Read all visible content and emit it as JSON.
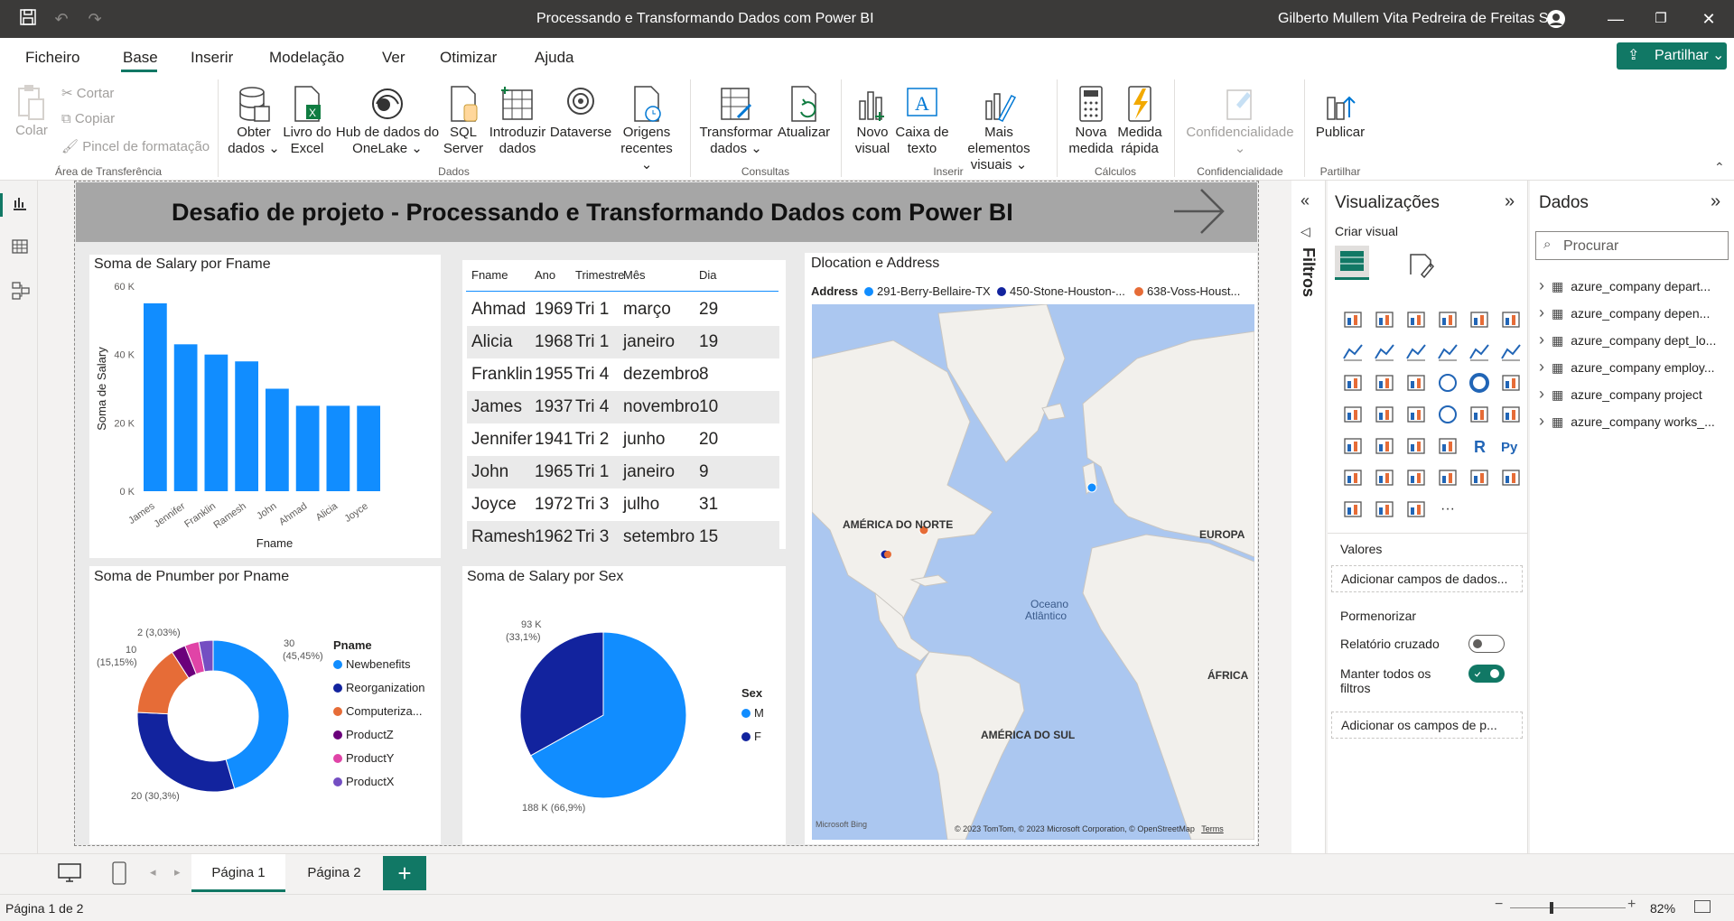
{
  "window": {
    "title": "Processando e Transformando Dados com Power BI",
    "user": "Gilberto Mullem Vita Pedreira de Freitas Sá"
  },
  "menu": [
    "Ficheiro",
    "Base",
    "Inserir",
    "Modelação",
    "Ver",
    "Otimizar",
    "Ajuda"
  ],
  "share_label": "Partilhar",
  "ribbon": {
    "paste": "Colar",
    "cut": "Cortar",
    "copy": "Copiar",
    "format_painter": "Pincel de formatação",
    "get_data_1": "Obter",
    "get_data_2": "dados",
    "excel_1": "Livro do",
    "excel_2": "Excel",
    "onelake_1": "Hub de dados do",
    "onelake_2": "OneLake",
    "sql_1": "SQL",
    "sql_2": "Server",
    "enter_1": "Introduzir",
    "enter_2": "dados",
    "dataverse": "Dataverse",
    "recent_1": "Origens",
    "recent_2": "recentes",
    "transform_1": "Transformar",
    "transform_2": "dados",
    "refresh": "Atualizar",
    "new_visual_1": "Novo",
    "new_visual_2": "visual",
    "textbox_1": "Caixa de",
    "textbox_2": "texto",
    "more_visuals_1": "Mais elementos",
    "more_visuals_2": "visuais",
    "new_measure_1": "Nova",
    "new_measure_2": "medida",
    "quick_measure_1": "Medida",
    "quick_measure_2": "rápida",
    "sensitivity": "Confidencialidade",
    "publish": "Publicar",
    "groups": {
      "clipboard": "Área de Transferência",
      "data": "Dados",
      "queries": "Consultas",
      "insert": "Inserir",
      "calculations": "Cálculos",
      "sensitivity": "Confidencialidade",
      "share": "Partilhar"
    }
  },
  "banner_title": "Desafio de projeto - Processando e Transformando Dados com Power BI",
  "bar_card": {
    "title": "Soma de Salary por Fname",
    "ylabel": "Soma de Salary",
    "xlabel": "Fname",
    "yticks": [
      "60 K",
      "40 K",
      "20 K",
      "0 K"
    ]
  },
  "table": {
    "headers": [
      "Fname",
      "Ano",
      "Trimestre",
      "Mês",
      "Dia"
    ],
    "rows": [
      [
        "Ahmad",
        "1969",
        "Tri 1",
        "março",
        "29"
      ],
      [
        "Alicia",
        "1968",
        "Tri 1",
        "janeiro",
        "19"
      ],
      [
        "Franklin",
        "1955",
        "Tri 4",
        "dezembro",
        "8"
      ],
      [
        "James",
        "1937",
        "Tri 4",
        "novembro",
        "10"
      ],
      [
        "Jennifer",
        "1941",
        "Tri 2",
        "junho",
        "20"
      ],
      [
        "John",
        "1965",
        "Tri 1",
        "janeiro",
        "9"
      ],
      [
        "Joyce",
        "1972",
        "Tri 3",
        "julho",
        "31"
      ],
      [
        "Ramesh",
        "1962",
        "Tri 3",
        "setembro",
        "15"
      ]
    ]
  },
  "map_card": {
    "title": "Dlocation e Address",
    "legend_title": "Address",
    "legend": [
      "291-Berry-Bellaire-TX",
      "450-Stone-Houston-...",
      "638-Voss-Houst..."
    ],
    "labels": [
      "AMÉRICA DO NORTE",
      "EUROPA",
      "Oceano",
      "Atlântico",
      "ÁFRICA",
      "AMÉRICA DO SUL"
    ],
    "copyright": "© 2023 TomTom, © 2023 Microsoft Corporation, © OpenStreetMap",
    "terms": "Terms",
    "bing": "Microsoft Bing"
  },
  "donut_card": {
    "title": "Soma de Pnumber por Pname",
    "legend_title": "Pname",
    "labels": [
      "30",
      "(45,45%)",
      "20 (30,3%)",
      "10",
      "(15,15%)",
      "2 (3,03%)"
    ]
  },
  "pie_card": {
    "title": "Soma de Salary por Sex",
    "legend_title": "Sex",
    "labels": [
      "93 K",
      "(33,1%)",
      "188 K (66,9%)"
    ]
  },
  "chart_data": [
    {
      "type": "bar",
      "title": "Soma de Salary por Fname",
      "xlabel": "Fname",
      "ylabel": "Soma de Salary",
      "categories": [
        "James",
        "Jennifer",
        "Franklin",
        "Ramesh",
        "John",
        "Ahmad",
        "Alicia",
        "Joyce"
      ],
      "values": [
        55000,
        43000,
        40000,
        38000,
        30000,
        25000,
        25000,
        25000
      ],
      "ylim": [
        0,
        60000
      ],
      "color": "#118dff"
    },
    {
      "type": "pie",
      "title": "Soma de Pnumber por Pname",
      "donut": true,
      "categories": [
        "Newbenefits",
        "Reorganization",
        "Computeriza...",
        "ProductZ",
        "ProductY",
        "ProductX"
      ],
      "values": [
        30,
        20,
        10,
        2,
        2,
        2
      ],
      "colors": [
        "#118dff",
        "#12239e",
        "#e66c37",
        "#6b007b",
        "#e044a7",
        "#744ec2"
      ]
    },
    {
      "type": "pie",
      "title": "Soma de Salary por Sex",
      "categories": [
        "M",
        "F"
      ],
      "values": [
        188000,
        93000
      ],
      "colors": [
        "#118dff",
        "#12239e"
      ]
    }
  ],
  "filters_label": "Filtros",
  "viz_pane": {
    "title": "Visualizações",
    "create": "Criar visual",
    "values": "Valores",
    "values_field": "Adicionar campos de dados...",
    "drill": "Pormenorizar",
    "cross_report": "Relatório cruzado",
    "keep_filters_1": "Manter todos os",
    "keep_filters_2": "filtros",
    "drill_field": "Adicionar os campos de p..."
  },
  "data_pane": {
    "title": "Dados",
    "search_placeholder": "Procurar",
    "tables": [
      "azure_company depart...",
      "azure_company depen...",
      "azure_company dept_lo...",
      "azure_company employ...",
      "azure_company project",
      "azure_company works_..."
    ]
  },
  "pages": [
    "Página 1",
    "Página 2"
  ],
  "status": {
    "page": "Página 1 de 2",
    "zoom": "82%"
  }
}
